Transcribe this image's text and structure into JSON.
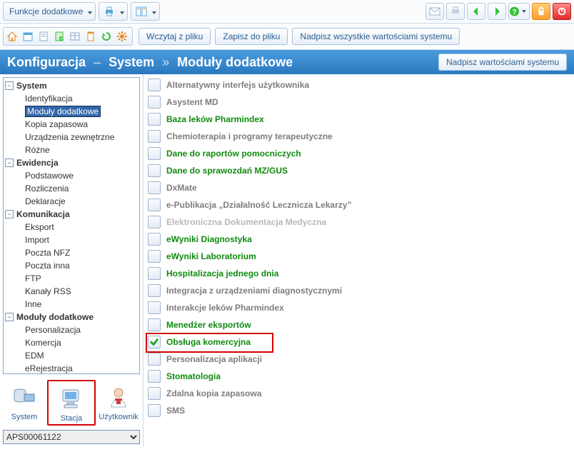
{
  "toolbar1": {
    "functions_label": "Funkcje dodatkowe"
  },
  "toolbar2": {
    "load_from_file": "Wczytaj z pliku",
    "save_to_file": "Zapisz do pliku",
    "overwrite_all": "Nadpisz wszystkie wartościami systemu"
  },
  "breadcrumb": {
    "root": "Konfiguracja",
    "level1": "System",
    "level2": "Moduły dodatkowe",
    "button": "Nadpisz wartościami systemu"
  },
  "tree": {
    "system": {
      "label": "System",
      "items": [
        "Identyfikacja",
        "Moduły dodatkowe",
        "Kopia zapasowa",
        "Urządzenia zewnętrzne",
        "Różne"
      ],
      "selected_index": 1
    },
    "ewidencja": {
      "label": "Ewidencja",
      "items": [
        "Podstawowe",
        "Rozliczenia",
        "Deklaracje"
      ]
    },
    "komunikacja": {
      "label": "Komunikacja",
      "items": [
        "Eksport",
        "Import",
        "Poczta NFZ",
        "Poczta inna",
        "FTP",
        "Kanały RSS",
        "Inne"
      ]
    },
    "moduly": {
      "label": "Moduły dodatkowe",
      "items": [
        "Personalizacja",
        "Komercja",
        "EDM",
        "eRejestracja"
      ]
    }
  },
  "left_tabs": {
    "system": "System",
    "stacja": "Stacja",
    "uzytkownik": "Użytkownik",
    "selected": "stacja"
  },
  "station": {
    "value": "APS00061122"
  },
  "modules": [
    {
      "label": "Alternatywny interfejs użytkownika",
      "style": "gray",
      "checked": false
    },
    {
      "label": "Asystent MD",
      "style": "gray",
      "checked": false
    },
    {
      "label": "Baza leków Pharmindex",
      "style": "green",
      "checked": false
    },
    {
      "label": "Chemioterapia i programy terapeutyczne",
      "style": "gray",
      "checked": false
    },
    {
      "label": "Dane do raportów pomocniczych",
      "style": "green",
      "checked": false
    },
    {
      "label": "Dane do sprawozdań MZ/GUS",
      "style": "green",
      "checked": false
    },
    {
      "label": "DxMate",
      "style": "gray",
      "checked": false
    },
    {
      "label": "e-Publikacja „Działalność Lecznicza Lekarzy”",
      "style": "gray",
      "checked": false
    },
    {
      "label": "Elektroniczna Dokumentacja Medyczna",
      "style": "lightgray",
      "checked": false
    },
    {
      "label": "eWyniki Diagnostyka",
      "style": "green",
      "checked": false
    },
    {
      "label": "eWyniki Laboratorium",
      "style": "green",
      "checked": false
    },
    {
      "label": "Hospitalizacja jednego dnia",
      "style": "green",
      "checked": false
    },
    {
      "label": "Integracja z urządzeniami diagnostycznymi",
      "style": "gray",
      "checked": false
    },
    {
      "label": "Interakcje leków Pharmindex",
      "style": "gray",
      "checked": false
    },
    {
      "label": "Menedżer eksportów",
      "style": "green",
      "checked": false
    },
    {
      "label": "Obsługa komercyjna",
      "style": "green",
      "checked": true,
      "highlight": true
    },
    {
      "label": "Personalizacja aplikacji",
      "style": "gray",
      "checked": false
    },
    {
      "label": "Stomatologia",
      "style": "green",
      "checked": false
    },
    {
      "label": "Zdalna kopia zapasowa",
      "style": "gray",
      "checked": false
    },
    {
      "label": "SMS",
      "style": "gray",
      "checked": false
    }
  ]
}
